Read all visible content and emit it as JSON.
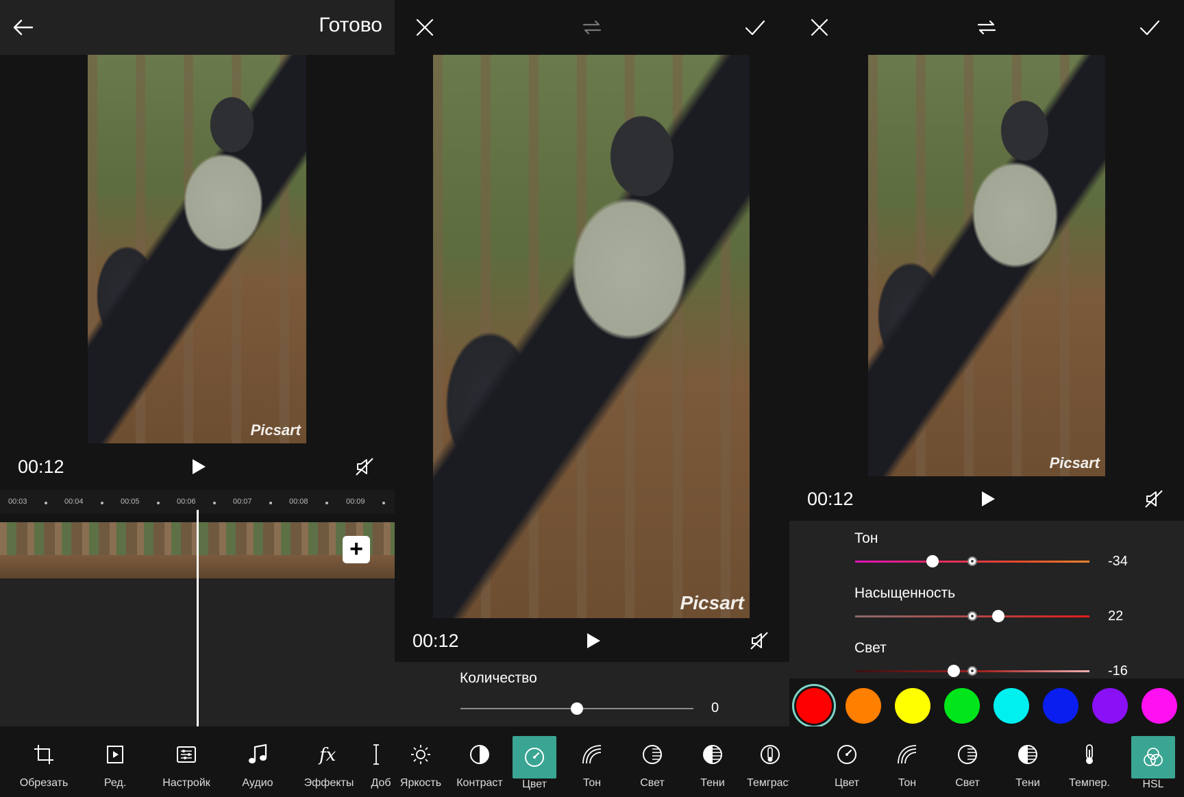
{
  "left_panel": {
    "done_label": "Готово",
    "watermark": "Picsart",
    "time": "00:12",
    "ruler_ticks": [
      "00:03",
      "00:04",
      "00:05",
      "00:06",
      "00:07",
      "00:08",
      "00:09"
    ],
    "add_clip": "+",
    "tools": [
      {
        "label": "Обрезать",
        "icon": "crop-icon"
      },
      {
        "label": "Ред.",
        "icon": "edit-clip-icon"
      },
      {
        "label": "Настройк",
        "icon": "adjust-icon"
      },
      {
        "label": "Аудио",
        "icon": "music-note-icon"
      },
      {
        "label": "Эффекты",
        "icon": "fx-icon"
      },
      {
        "label": "Доб",
        "icon": "add-icon"
      }
    ]
  },
  "middle_panel": {
    "watermark": "Picsart",
    "time": "00:12",
    "amount_label": "Количество",
    "amount_value": "0",
    "amount_position": 0.5,
    "tools": [
      {
        "label": "Яркость",
        "icon": "brightness-icon"
      },
      {
        "label": "Контраст",
        "icon": "contrast-icon"
      },
      {
        "label": "Цвет",
        "icon": "color-dial-icon",
        "active": true
      },
      {
        "label": "Тон",
        "icon": "tone-icon"
      },
      {
        "label": "Свет",
        "icon": "highlights-icon"
      },
      {
        "label": "Тени",
        "icon": "shadows-icon"
      },
      {
        "label": "Темграст",
        "icon": "temperature-icon"
      }
    ]
  },
  "right_panel": {
    "watermark": "Picsart",
    "time": "00:12",
    "hsl": [
      {
        "label": "Тон",
        "value": "-34",
        "knob": 0.33,
        "gradient": "linear-gradient(90deg,#e012b8,#e0305a 40%,#e44a2a 70%,#e8842c)"
      },
      {
        "label": "Насыщенность",
        "value": "22",
        "knob": 0.61,
        "gradient": "linear-gradient(90deg,#8c6b6b,#b04848 50%,#e31c1c)"
      },
      {
        "label": "Свет",
        "value": "-16",
        "knob": 0.42,
        "gradient": "linear-gradient(90deg,#3a0f0f,#a62222 55%,#f0b0b0)"
      }
    ],
    "swatches": [
      "#ff0000",
      "#ff7f00",
      "#ffff00",
      "#00e61a",
      "#00f0f0",
      "#0a1ef0",
      "#8a10f5",
      "#ff10f0"
    ],
    "tools": [
      {
        "label": "Цвет",
        "icon": "color-dial-icon"
      },
      {
        "label": "Тон",
        "icon": "tone-icon"
      },
      {
        "label": "Свет",
        "icon": "highlights-icon"
      },
      {
        "label": "Тени",
        "icon": "shadows-icon"
      },
      {
        "label": "Темпер.",
        "icon": "thermometer-icon"
      },
      {
        "label": "HSL",
        "icon": "hsl-icon",
        "active": true
      }
    ]
  }
}
